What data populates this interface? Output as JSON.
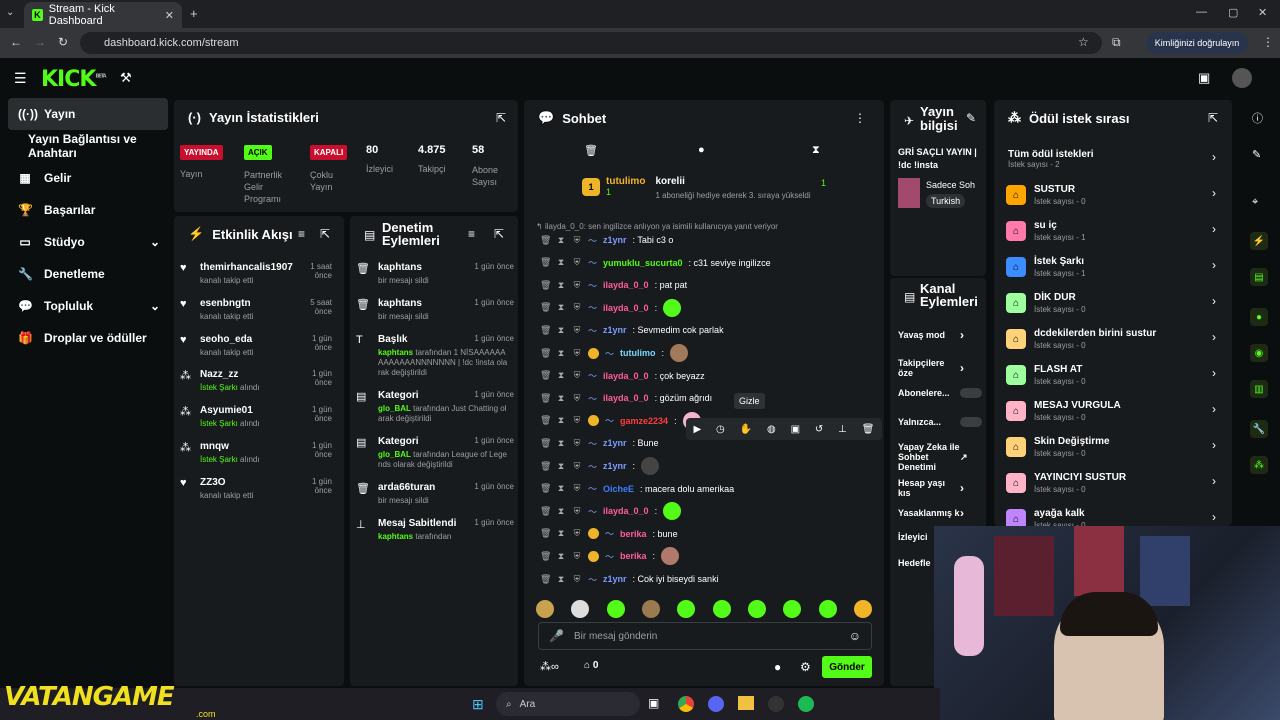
{
  "browser": {
    "tab_title": "Stream - Kick Dashboard",
    "url": "dashboard.kick.com/stream",
    "verify_label": "Kimliğinizi doğrulayın"
  },
  "app": {
    "logo": "KICK",
    "logo_sup": "BETA"
  },
  "sidebar": {
    "items": [
      {
        "label": "Yayın",
        "icon": "broadcast-icon"
      },
      {
        "label": "Yayın Bağlantısı ve Anahtarı"
      },
      {
        "label": "Gelir",
        "icon": "revenue-icon"
      },
      {
        "label": "Başarılar",
        "icon": "trophy-icon"
      },
      {
        "label": "Stüdyo",
        "icon": "studio-icon"
      },
      {
        "label": "Denetleme",
        "icon": "wrench-icon"
      },
      {
        "label": "Topluluk",
        "icon": "community-icon"
      },
      {
        "label": "Droplar ve ödüller",
        "icon": "gift-icon"
      }
    ]
  },
  "stats": {
    "title": "Yayın İstatistikleri",
    "items": [
      {
        "badge": "YAYINDA",
        "label": "Yayın",
        "color": "#c8102e"
      },
      {
        "badge": "AÇIK",
        "label": "Partnerlik Gelir Programı",
        "color": "#53fc18"
      },
      {
        "badge": "KAPALI",
        "label": "Çoklu Yayın",
        "color": "#c8102e"
      },
      {
        "value": "80",
        "label": "İzleyici"
      },
      {
        "value": "4.875",
        "label": "Takipçi"
      },
      {
        "value": "58",
        "label": "Abone Sayısı"
      }
    ]
  },
  "activity": {
    "title": "Etkinlik Akışı",
    "items": [
      {
        "name": "themirhancalis1907",
        "time": "1 saat önce",
        "sub": "kanalı takip etti"
      },
      {
        "name": "esenbngtn",
        "time": "5 saat önce",
        "sub": "kanalı takip etti"
      },
      {
        "name": "seoho_eda",
        "time": "1 gün önce",
        "sub": "kanalı takip etti"
      },
      {
        "name": "Nazz_zz",
        "time": "1 gün önce",
        "sub_hl": "İstek Şarkı",
        "sub": " alındı"
      },
      {
        "name": "Asyumie01",
        "time": "1 gün önce",
        "sub_hl": "İstek Şarkı",
        "sub": " alındı"
      },
      {
        "name": "mnqw",
        "time": "1 gün önce",
        "sub_hl": "İstek Şarkı",
        "sub": " alındı"
      },
      {
        "name": "ZZ3O",
        "time": "1 gün önce",
        "sub": "kanalı takip etti"
      }
    ]
  },
  "moderation": {
    "title": "Denetim Eylemleri",
    "items": [
      {
        "name": "kaphtans",
        "time": "1 gün önce",
        "sub": "bir mesajı sildi"
      },
      {
        "name": "kaphtans",
        "time": "1 gün önce",
        "sub": "bir mesajı sildi"
      },
      {
        "name": "Başlık",
        "time": "1 gün önce",
        "hl": "kaphtans",
        "sub": " tarafından 1 NİSAAAAAAAAAAAAANNNNNNN | !dc !insta olarak değiştirildi"
      },
      {
        "name": "Kategori",
        "time": "1 gün önce",
        "hl": "glo_BAL",
        "sub": " tarafından Just Chatting olarak değiştirildi"
      },
      {
        "name": "Kategori",
        "time": "1 gün önce",
        "hl": "glo_BAL",
        "sub": " tarafından League of Legends olarak değiştirildi"
      },
      {
        "name": "arda66turan",
        "time": "1 gün önce",
        "sub": "bir mesajı sildi"
      },
      {
        "name": "Mesaj Sabitlendi",
        "time": "1 gün önce",
        "hl": "kaphtans",
        "sub": " tarafından"
      }
    ]
  },
  "chat": {
    "title": "Sohbet",
    "pinned_user": "tutulimo",
    "pinned_count": "1",
    "pinned_target": "korelii",
    "pinned_text": "1 aboneliği hediye ederek 3. sıraya yükseldi",
    "pinned_right": "1",
    "reply_note": "ilayda_0_0: sen ingilizce anlıyon ya isimili kullanıcıya yanıt veriyor",
    "messages": [
      {
        "user": "z1ynr",
        "text": ": Tabi c3 o",
        "color": "#7b9cff"
      },
      {
        "user": "yumuklu_sucurta0",
        "text": ": c31 seviye ingilizce",
        "color": "#53fc18"
      },
      {
        "user": "ilayda_0_0",
        "text": ": pat pat",
        "color": "#ff5c9d"
      },
      {
        "user": "ilayda_0_0",
        "text": ":",
        "color": "#ff5c9d"
      },
      {
        "user": "z1ynr",
        "text": ": Sevmedim cok parlak",
        "color": "#7b9cff"
      },
      {
        "user": "tutulimo",
        "text": ":",
        "color": "#7bd6ff"
      },
      {
        "user": "ilayda_0_0",
        "text": ": çok beyazz",
        "color": "#ff5c9d"
      },
      {
        "user": "ilayda_0_0",
        "text": ": gözüm ağrıdı",
        "color": "#ff5c9d"
      },
      {
        "user": "gamze2234",
        "text": ":",
        "color": "#ff3c3c"
      },
      {
        "user": "z1ynr",
        "text": ": Bune",
        "color": "#7b9cff"
      },
      {
        "user": "z1ynr",
        "text": ":",
        "color": "#7b9cff"
      },
      {
        "user": "OicheE",
        "text": ": macera dolu amerikaa",
        "color": "#3c7dff"
      },
      {
        "user": "ilayda_0_0",
        "text": ":",
        "color": "#ff5c9d"
      },
      {
        "user": "berika",
        "text": ": bune",
        "color": "#ff5c9d"
      },
      {
        "user": "berika",
        "text": ":",
        "color": "#ff5c9d"
      },
      {
        "user": "z1ynr",
        "text": ": Cok iyi biseydi sanki",
        "color": "#7b9cff"
      }
    ],
    "tooltip": "Gizle",
    "input_placeholder": "Bir mesaj gönderin",
    "points": "0",
    "send_label": "Gönder"
  },
  "stream_info": {
    "title": "Yayın bilgisi",
    "stream_title": "GRİ SAÇLI YAYIN | !dc !insta",
    "category": "Sadece Soh",
    "language": "Turkish"
  },
  "channel_actions": {
    "title": "Kanal Eylemleri",
    "items": [
      "Yavaş mod",
      "Takipçilere öze",
      "Abonelere...",
      "Yalnızca...",
      "Yapay Zeka ile Sohbet Denetimi",
      "Hesap yaşı kıs",
      "Yasaklanmış k",
      "İzleyici",
      "Hedefle"
    ]
  },
  "rewards": {
    "title": "Ödül istek sırası",
    "all_label": "Tüm ödül istekleri",
    "all_count": "İstek sayısı - 2",
    "items": [
      {
        "name": "SUSTUR",
        "count": "İstek sayısı - 0",
        "color": "#ffa500"
      },
      {
        "name": "su iç",
        "count": "İstek sayısı - 1",
        "color": "#ff7aa8"
      },
      {
        "name": "İstek Şarkı",
        "count": "İstek sayısı - 1",
        "color": "#3c8dff"
      },
      {
        "name": "DİK DUR",
        "count": "İstek sayısı - 0",
        "color": "#9dff9d"
      },
      {
        "name": "dcdekilerden birini sustur",
        "count": "İstek sayısı - 0",
        "color": "#ffd27a"
      },
      {
        "name": "FLASH AT",
        "count": "İstek sayısı - 0",
        "color": "#9dff9d"
      },
      {
        "name": "MESAJ VURGULA",
        "count": "İstek sayısı - 0",
        "color": "#ffb3c6"
      },
      {
        "name": "Skin Değiştirme",
        "count": "İstek sayısı - 0",
        "color": "#ffd27a"
      },
      {
        "name": "YAYINCIYI SUSTUR",
        "count": "İstek sayısı - 0",
        "color": "#ffb3c6"
      },
      {
        "name": "ayağa kalk",
        "count": "İstek sayısı - 0",
        "color": "#c084fc"
      }
    ]
  },
  "taskbar": {
    "search": "Ara",
    "watermark": "VATANGAME",
    "watermark_sub": ".com"
  }
}
